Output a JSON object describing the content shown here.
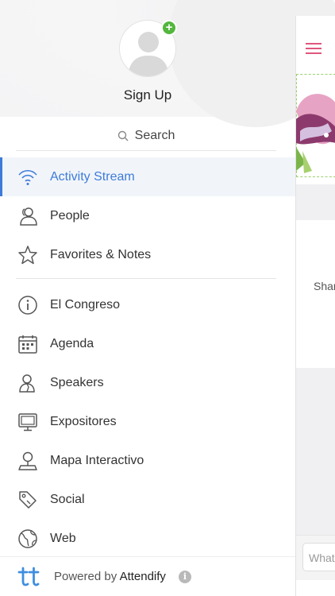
{
  "profile": {
    "signup_label": "Sign Up",
    "avatar_icon": "person-icon",
    "add_icon": "plus-icon",
    "add_symbol": "+"
  },
  "search": {
    "label": "Search",
    "icon": "search-icon"
  },
  "menu": {
    "items": [
      {
        "label": "Activity Stream",
        "icon": "wifi-icon",
        "active": true
      },
      {
        "label": "People",
        "icon": "people-icon"
      },
      {
        "label": "Favorites & Notes",
        "icon": "star-icon"
      },
      {
        "label": "El Congreso",
        "icon": "info-icon"
      },
      {
        "label": "Agenda",
        "icon": "calendar-icon"
      },
      {
        "label": "Speakers",
        "icon": "speaker-icon"
      },
      {
        "label": "Expositores",
        "icon": "monitor-icon"
      },
      {
        "label": "Mapa Interactivo",
        "icon": "map-pin-icon"
      },
      {
        "label": "Social",
        "icon": "tag-icon"
      },
      {
        "label": "Web",
        "icon": "globe-icon"
      }
    ]
  },
  "footer": {
    "powered_prefix": "Powered by",
    "brand": "Attendify",
    "info_symbol": "i"
  },
  "panel": {
    "card_text": "Shar",
    "input_placeholder": "What"
  },
  "colors": {
    "accent": "#3e7bd8",
    "add_badge": "#53b63d",
    "hamburger": "#e0567e"
  }
}
